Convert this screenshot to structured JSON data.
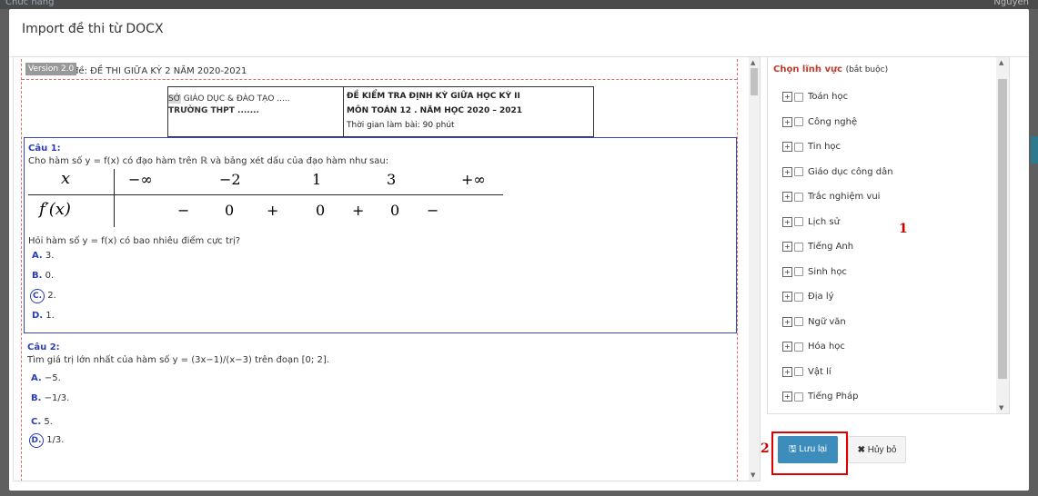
{
  "background": {
    "left_text": "Chức năng",
    "right_text": "Nguyễn"
  },
  "modal": {
    "title": "Import đề thi từ DOCX"
  },
  "document": {
    "version": "Version 2.0",
    "name": "Tên bộ đề: ĐỀ THI GIỮA KỲ 2 NĂM 2020-2021",
    "header": {
      "dept_prefix": "SỞ",
      "dept_rest": " GIÁO DỤC & ĐÀO TẠO .....",
      "school": "TRƯỜNG THPT .......",
      "exam_title": "ĐỀ KIỂM TRA ĐỊNH KỲ GIỮA HỌC KỲ II",
      "subject": "MÔN TOÁN 12 . NĂM HỌC 2020 – 2021",
      "time": "Thời gian làm bài: 90 phút"
    },
    "q1": {
      "label": "Câu 1:",
      "text": "Cho hàm số y = f(x) có đạo hàm trên ℝ và bảng xét dấu của đạo hàm như sau:",
      "table_x": [
        "x",
        "−∞",
        "−2",
        "1",
        "3",
        "+∞"
      ],
      "table_fx": [
        "f′(x)",
        "−",
        "0",
        "+",
        "0",
        "+",
        "0",
        "−"
      ],
      "question": "Hỏi hàm số y = f(x) có bao nhiêu điểm cực trị?",
      "answers": [
        {
          "key": "A.",
          "value": "3."
        },
        {
          "key": "B.",
          "value": "0."
        },
        {
          "key": "C.",
          "value": "2."
        },
        {
          "key": "D.",
          "value": "1."
        }
      ]
    },
    "q2": {
      "label": "Câu 2:",
      "text": "Tìm giá trị lớn nhất của hàm số y = (3x−1)/(x−3) trên đoạn [0; 2].",
      "answers": [
        {
          "key": "A.",
          "value": "−5."
        },
        {
          "key": "B.",
          "value": "−1/3."
        },
        {
          "key": "C.",
          "value": "5."
        },
        {
          "key": "D.",
          "value": "1/3."
        }
      ]
    }
  },
  "fields": {
    "title": "Chọn lĩnh vực",
    "required": "(bắt buộc)",
    "items": [
      "Toán học",
      "Công nghệ",
      "Tin học",
      "Giáo dục công dân",
      "Trắc nghiệm vui",
      "Lịch sử",
      "Tiếng Anh",
      "Sinh học",
      "Địa lý",
      "Ngữ văn",
      "Hóa học",
      "Vật lí",
      "Tiếng Pháp"
    ]
  },
  "annotations": {
    "one": "1",
    "two": "2"
  },
  "buttons": {
    "save": "Lưu lại",
    "cancel": "Hủy bỏ",
    "save_icon": "floppy-icon",
    "cancel_icon": "x-icon"
  },
  "colors": {
    "primary": "#3c8dbc",
    "question_border": "#3846b9",
    "annotation": "#cc0000"
  }
}
